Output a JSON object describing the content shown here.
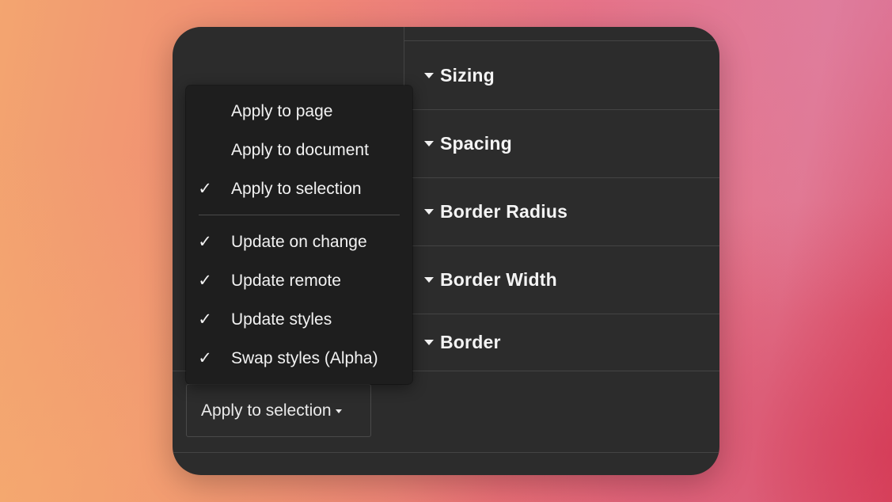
{
  "sections": [
    {
      "title": "Sizing"
    },
    {
      "title": "Spacing"
    },
    {
      "title": "Border Radius"
    },
    {
      "title": "Border Width"
    },
    {
      "title": "Border"
    }
  ],
  "apply_button": {
    "label": "Apply to selection"
  },
  "menu": {
    "check_glyph": "✓",
    "scope_items": [
      {
        "label": "Apply to page",
        "checked": false
      },
      {
        "label": "Apply to document",
        "checked": false
      },
      {
        "label": "Apply to selection",
        "checked": true
      }
    ],
    "option_items": [
      {
        "label": "Update on change",
        "checked": true
      },
      {
        "label": "Update remote",
        "checked": true
      },
      {
        "label": "Update styles",
        "checked": true
      },
      {
        "label": "Swap styles (Alpha)",
        "checked": true
      }
    ]
  }
}
